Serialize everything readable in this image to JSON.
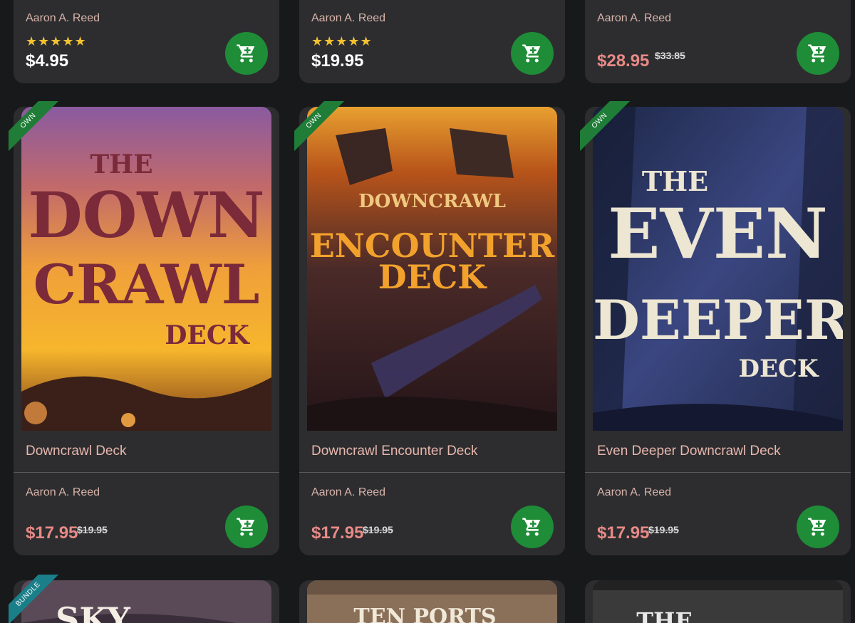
{
  "top_row": [
    {
      "author": "Aaron A. Reed",
      "stars": "★★★★★",
      "price": "$4.95",
      "old_price": ""
    },
    {
      "author": "Aaron A. Reed",
      "stars": "★★★★★",
      "price": "$19.95",
      "old_price": ""
    },
    {
      "author": "Aaron A. Reed",
      "stars": "",
      "price": "$28.95",
      "old_price": "$33.85"
    }
  ],
  "products": [
    {
      "badge": "OWN",
      "title": "Downcrawl Deck",
      "author": "Aaron A. Reed",
      "price": "$17.95",
      "old_price": "$19.95",
      "cover_lines": [
        "THE",
        "DOWN",
        "CRAWL",
        "DECK"
      ]
    },
    {
      "badge": "OWN",
      "title": "Downcrawl Encounter Deck",
      "author": "Aaron A. Reed",
      "price": "$17.95",
      "old_price": "$19.95",
      "cover_lines": [
        "DOWNCRAWL",
        "ENCOUNTER",
        "DECK"
      ]
    },
    {
      "badge": "OWN",
      "title": "Even Deeper Downcrawl Deck",
      "author": "Aaron A. Reed",
      "price": "$17.95",
      "old_price": "$19.95",
      "cover_lines": [
        "THE",
        "EVEN",
        "DEEPER",
        "DECK"
      ]
    }
  ],
  "bottom_row": [
    {
      "badge": "BUNDLE",
      "cover_text": "SKY"
    },
    {
      "badge": "",
      "cover_text": "TEN PORTS"
    },
    {
      "badge": "",
      "cover_text": "THE"
    }
  ],
  "colors": {
    "page_bg": "#18191b",
    "card_bg": "#2d2d2f",
    "cart_green": "#1f8c38",
    "sale_price": "#e88a87",
    "star_yellow": "#f2c230",
    "own_ribbon": "#1f7d37",
    "bundle_ribbon": "#1b7f8a"
  },
  "icons": {
    "cart": "add-to-cart-icon",
    "rating": "star-icon"
  }
}
